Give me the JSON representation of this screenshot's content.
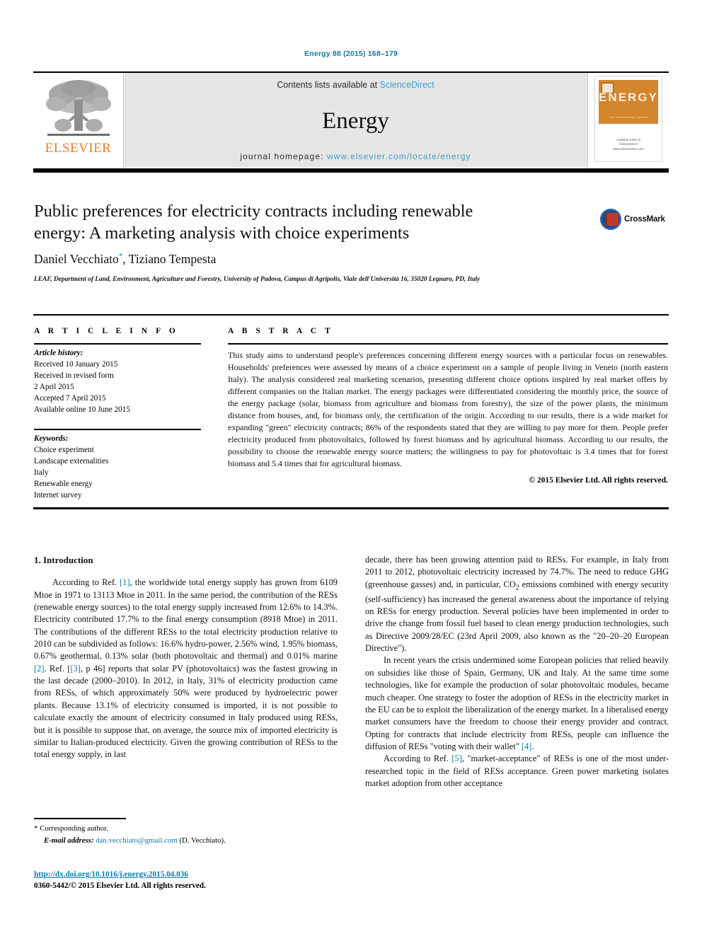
{
  "running_head": "Energy 88 (2015) 168–179",
  "masthead": {
    "publisher_name": "ELSEVIER",
    "contents_prefix": "Contents lists available at ",
    "contents_link": "ScienceDirect",
    "journal_name": "Energy",
    "homepage_prefix": "journal homepage: ",
    "homepage_url": "www.elsevier.com/locate/energy",
    "cover_title": "ENERGY",
    "cover_sub": "The International Journal",
    "cover_footer_1": "Available online at",
    "cover_footer_2": "ScienceDirect",
    "cover_footer_3": "www.sciencedirect.com"
  },
  "article": {
    "title": "Public preferences for electricity contracts including renewable energy: A marketing analysis with choice experiments",
    "authors": "Daniel Vecchiato",
    "authors_rest": ", Tiziano Tempesta",
    "author_marker": "*",
    "affiliation": "LEAF, Department of Land, Environment, Agriculture and Forestry, University of Padova, Campus di Agripolis, Viale dell'Università 16, 35020 Legnaro, PD, Italy",
    "crossmark_label": "CrossMark"
  },
  "article_info": {
    "header": "A R T I C L E  I N F O",
    "history_label": "Article history:",
    "history": [
      "Received 10 January 2015",
      "Received in revised form",
      "2 April 2015",
      "Accepted 7 April 2015",
      "Available online 10 June 2015"
    ],
    "keywords_label": "Keywords:",
    "keywords": [
      "Choice experiment",
      "Landscape externalities",
      "Italy",
      "Renewable energy",
      "Internet survey"
    ]
  },
  "abstract": {
    "header": "A B S T R A C T",
    "text": "This study aims to understand people's preferences concerning different energy sources with a particular focus on renewables. Households' preferences were assessed by means of a choice experiment on a sample of people living in Veneto (north eastern Italy). The analysis considered real marketing scenarios, presenting different choice options inspired by real market offers by different companies on the Italian market. The energy packages were differentiated considering the monthly price, the source of the energy package (solar, biomass from agriculture and biomass from forestry), the size of the power plants, the minimum distance from houses, and, for biomass only, the certification of the origin. According to our results, there is a wide market for expanding \"green\" electricity contracts; 86% of the respondents stated that they are willing to pay more for them. People prefer electricity produced from photovoltaics, followed by forest biomass and by agricultural biomass. According to our results, the possibility to choose the renewable energy source matters; the willingness to pay for photovoltaic is 3.4 times that for forest biomass and 5.4 times that for agricultural biomass.",
    "copyright": "© 2015 Elsevier Ltd. All rights reserved."
  },
  "body": {
    "section_heading": "1. Introduction",
    "left_paragraph_1_a": "According to Ref. ",
    "left_ref_1": "[1]",
    "left_paragraph_1_b": ", the worldwide total energy supply has grown from 6109 Mtoe in 1971 to 13113 Mtoe in 2011. In the same period, the contribution of the RESs (renewable energy sources) to the total energy supply increased from 12.6% to 14.3%. Electricity contributed 17.7% to the final energy consumption (8918 Mtoe) in 2011. The contributions of the different RESs to the total electricity production relative to 2010 can be subdivided as follows: 16.6% hydro-power, 2.56% wind, 1.95% biomass, 0.67% geothermal, 0.13% solar (both photovoltaic and thermal) and 0.01% marine ",
    "left_ref_2": "[2]",
    "left_paragraph_1_c": ". Ref. [",
    "left_ref_3": "[3]",
    "left_paragraph_1_d": ", p 46] reports that solar PV (photovoltaics) was the fastest growing in the last decade (2000–2010). In 2012, in Italy, 31% of electricity production came from RESs, of which approximately 50% were produced by hydroelectric power plants. Because 13.1% of electricity consumed is imported, it is not possible to calculate exactly the amount of electricity consumed in Italy produced using RESs, but it is possible to suppose that, on average, the source mix of imported electricity is similar to Italian-produced electricity. Given the growing contribution of RESs to the total energy supply, in last",
    "right_paragraph_1": "decade, there has been growing attention paid to RESs. For example, in Italy from 2011 to 2012, photovoltaic electricity increased by 74.7%. The need to reduce GHG (greenhouse gasses) and, in particular, CO",
    "right_paragraph_1_sub": "2",
    "right_paragraph_1_b": " emissions combined with energy security (self-sufficiency) has increased the general awareness about the importance of relying on RESs for energy production. Several policies have been implemented in order to drive the change from fossil fuel based to clean energy production technologies, such as Directive 2009/28/EC (23rd April 2009, also known as the \"20–20–20 European Directive\").",
    "right_paragraph_2": "In recent years the crisis undermined some European policies that relied heavily on subsidies like those of Spain, Germany, UK and Italy. At the same time some technologies, like for example the production of solar photovoltaic modules, became much cheaper. One strategy to foster the adoption of RESs in the electricity market in the EU can be to exploit the liberalization of the energy market. In a liberalised energy market consumers have the freedom to choose their energy provider and contract. Opting for contracts that include electricity from RESs, people can influence the diffusion of RESs \"voting with their wallet\" ",
    "right_ref_4": "[4]",
    "right_paragraph_2_b": ".",
    "right_paragraph_3_a": "According to Ref. ",
    "right_ref_5": "[5]",
    "right_paragraph_3_b": ", \"market-acceptance\" of RESs is one of the most under-researched topic in the field of RESs acceptance. Green power marketing isolates market adoption from other acceptance"
  },
  "footer": {
    "corresponding_marker": "*",
    "corresponding_label": "Corresponding author.",
    "email_label": "E-mail address:",
    "email": "dan.vecchiato@gmail.com",
    "email_suffix": "(D. Vecchiato).",
    "doi": "http://dx.doi.org/10.1016/j.energy.2015.04.036",
    "issn": "0360-5442/© 2015 Elsevier Ltd. All rights reserved."
  },
  "colors": {
    "link_blue": "#0c7ba8",
    "sciencedirect_blue": "#3f9ec9",
    "elsevier_orange": "#f07c22",
    "cover_orange": "#d3862c"
  }
}
